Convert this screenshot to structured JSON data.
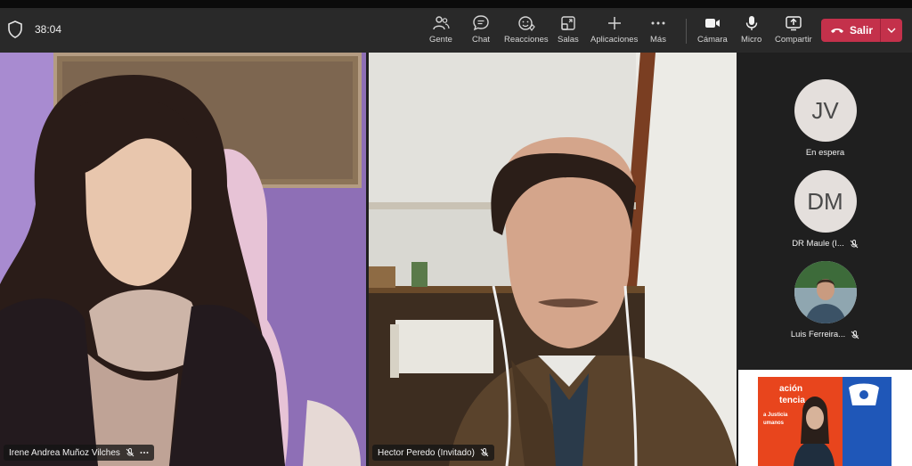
{
  "toolbar": {
    "timer": "38:04",
    "buttons": [
      {
        "key": "people",
        "label": "Gente",
        "icon": "people-icon"
      },
      {
        "key": "chat",
        "label": "Chat",
        "icon": "chat-icon"
      },
      {
        "key": "reactions",
        "label": "Reacciones",
        "icon": "reactions-icon"
      },
      {
        "key": "rooms",
        "label": "Salas",
        "icon": "rooms-icon"
      },
      {
        "key": "apps",
        "label": "Aplicaciones",
        "icon": "plus-icon"
      },
      {
        "key": "more",
        "label": "Más",
        "icon": "more-icon"
      },
      {
        "key": "camera",
        "label": "Cámara",
        "icon": "camera-icon"
      },
      {
        "key": "mic",
        "label": "Micro",
        "icon": "mic-icon"
      },
      {
        "key": "share",
        "label": "Compartir",
        "icon": "share-icon"
      }
    ],
    "leave_label": "Salir",
    "leave_color": "#c4314b"
  },
  "stage": {
    "videos": [
      {
        "name": "Irene Andrea Muñoz Vilches",
        "muted": true
      },
      {
        "name": "Hector Peredo (Invitado)",
        "muted": true
      }
    ],
    "roster": [
      {
        "initials": "JV",
        "name": "En espera",
        "muted": false
      },
      {
        "initials": "DM",
        "name": "DR Maule (I...",
        "muted": true
      },
      {
        "initials": "",
        "name": "Luis Ferreira...",
        "muted": true
      }
    ],
    "selfview_text": [
      "ación",
      "tencia",
      "a Justicia",
      "umanos"
    ]
  }
}
